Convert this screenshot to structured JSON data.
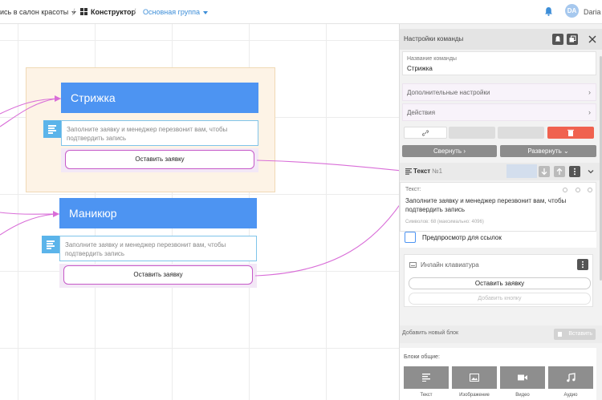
{
  "topbar": {
    "bot_name": "ись в салон красоты",
    "constructor": "Конструктор",
    "group": "Основная группа",
    "user_initials": "DA",
    "user_name": "Daria"
  },
  "canvas": {
    "blocks": [
      {
        "title": "Стрижка",
        "text": "Заполните заявку и менеджер перезвонит вам, чтобы подтвердить запись",
        "button": "Оставить заявку"
      },
      {
        "title": "Маникюр",
        "text": "Заполните заявку и менеджер перезвонит вам, чтобы подтвердить запись",
        "button": "Оставить заявку"
      }
    ]
  },
  "panel": {
    "header": "Настройки команды",
    "name_label": "Название команды",
    "name_value": "Стрижка",
    "extra_settings": "Дополнительные настройки",
    "actions": "Действия",
    "collapse": "Свернуть",
    "expand": "Развернуть",
    "text_block": {
      "title": "Текст",
      "number": "№1",
      "field_label": "Текст:",
      "content": "Заполните заявку и менеджер перезвонит вам, чтобы подтвердить запись",
      "counter": "Символов: 68 (максимально: 4096)",
      "preview_label": "Предпросмотр для ссылок"
    },
    "inline_kb": {
      "title": "Инлайн клавиатура",
      "button": "Оставить заявку",
      "add_button": "Добавить кнопку"
    },
    "add_block": "Добавить новый блок",
    "paste": "Вставить",
    "blocks_label": "Блоки общие:",
    "tiles": [
      "Текст",
      "Изображение",
      "Видео",
      "Аудио"
    ]
  },
  "colors": {
    "accent_blue": "#4d94f2",
    "connector": "#d96ed8",
    "delete_red": "#f0624f"
  }
}
